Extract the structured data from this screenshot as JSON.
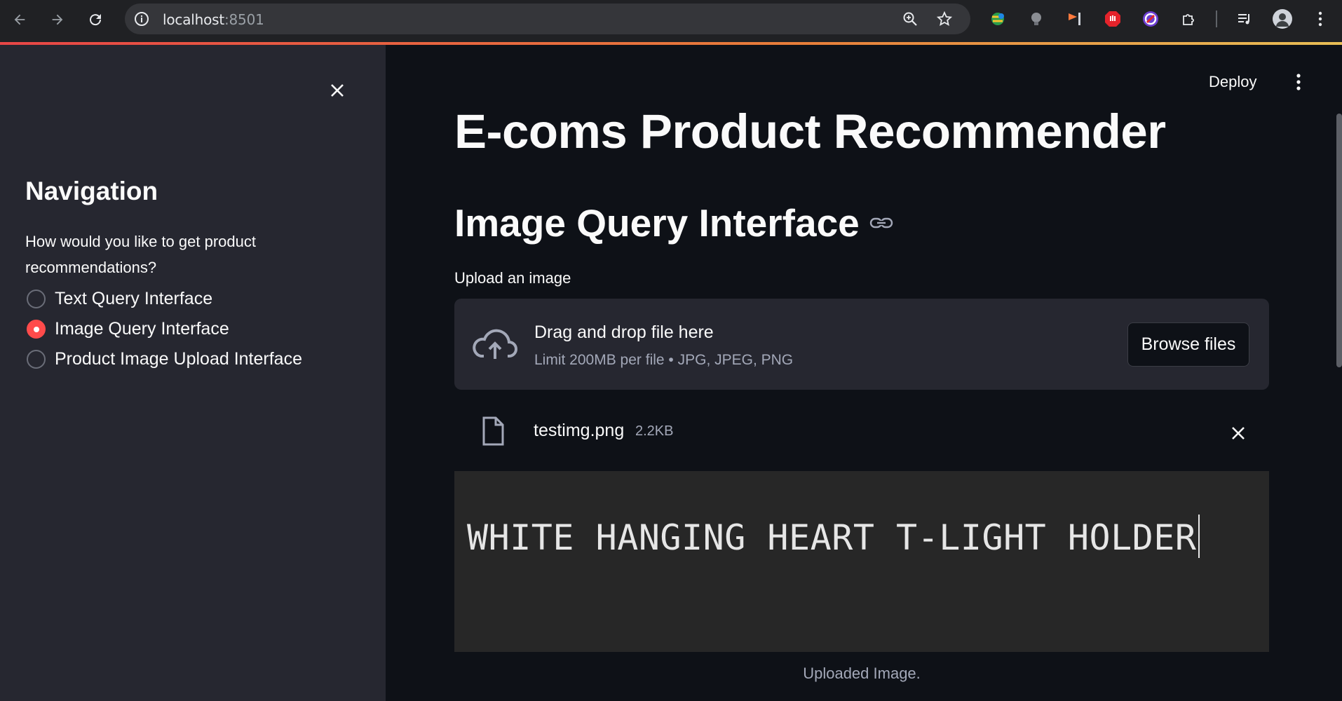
{
  "browser": {
    "url_host": "localhost",
    "url_port": ":8501"
  },
  "sidebar": {
    "heading": "Navigation",
    "question": "How would you like to get product recommendations?",
    "options": [
      {
        "label": "Text Query Interface",
        "selected": false
      },
      {
        "label": "Image Query Interface",
        "selected": true
      },
      {
        "label": "Product Image Upload Interface",
        "selected": false
      }
    ]
  },
  "header": {
    "deploy_label": "Deploy"
  },
  "main": {
    "title": "E-coms Product Recommender",
    "subtitle": "Image Query Interface",
    "upload_label": "Upload an image",
    "dropzone": {
      "title": "Drag and drop file here",
      "limit": "Limit 200MB per file • JPG, JPEG, PNG",
      "browse_label": "Browse files"
    },
    "file": {
      "name": "testimg.png",
      "size": "2.2KB"
    },
    "preview_text": "WHITE HANGING HEART T-LIGHT HOLDER",
    "caption": "Uploaded Image."
  },
  "colors": {
    "accent": "#ff4b4b",
    "sidebar_bg": "#262730",
    "main_bg": "#0e1117"
  }
}
